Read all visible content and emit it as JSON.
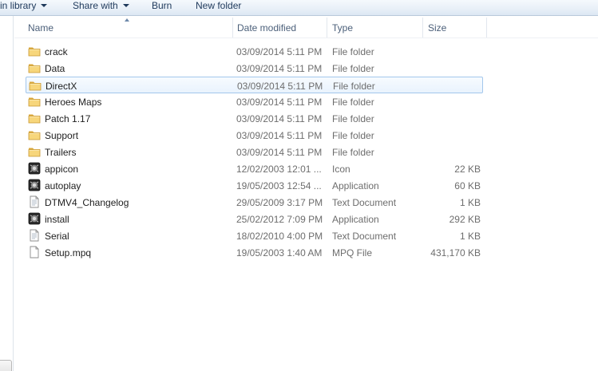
{
  "toolbar": {
    "include_in_library": "in library",
    "share_with": "Share with",
    "burn": "Burn",
    "new_folder": "New folder"
  },
  "columns": {
    "name": "Name",
    "date_modified": "Date modified",
    "type": "Type",
    "size": "Size"
  },
  "files": [
    {
      "name": "crack",
      "date": "03/09/2014 5:11 PM",
      "type": "File folder",
      "size": "",
      "icon": "folder-icon"
    },
    {
      "name": "Data",
      "date": "03/09/2014 5:11 PM",
      "type": "File folder",
      "size": "",
      "icon": "folder-icon"
    },
    {
      "name": "DirectX",
      "date": "03/09/2014 5:11 PM",
      "type": "File folder",
      "size": "",
      "icon": "folder-icon",
      "selected": true
    },
    {
      "name": "Heroes Maps",
      "date": "03/09/2014 5:11 PM",
      "type": "File folder",
      "size": "",
      "icon": "folder-icon"
    },
    {
      "name": "Patch 1.17",
      "date": "03/09/2014 5:11 PM",
      "type": "File folder",
      "size": "",
      "icon": "folder-icon"
    },
    {
      "name": "Support",
      "date": "03/09/2014 5:11 PM",
      "type": "File folder",
      "size": "",
      "icon": "folder-icon"
    },
    {
      "name": "Trailers",
      "date": "03/09/2014 5:11 PM",
      "type": "File folder",
      "size": "",
      "icon": "folder-icon"
    },
    {
      "name": "appicon",
      "date": "12/02/2003 12:01 ...",
      "type": "Icon",
      "size": "22 KB",
      "icon": "game-icon"
    },
    {
      "name": "autoplay",
      "date": "19/05/2003 12:54 ...",
      "type": "Application",
      "size": "60 KB",
      "icon": "game-icon"
    },
    {
      "name": "DTMV4_Changelog",
      "date": "29/05/2009 3:17 PM",
      "type": "Text Document",
      "size": "1 KB",
      "icon": "text-document-icon"
    },
    {
      "name": "install",
      "date": "25/02/2012 7:09 PM",
      "type": "Application",
      "size": "292 KB",
      "icon": "game-icon"
    },
    {
      "name": "Serial",
      "date": "18/02/2010 4:00 PM",
      "type": "Text Document",
      "size": "1 KB",
      "icon": "text-document-icon"
    },
    {
      "name": "Setup.mpq",
      "date": "19/05/2003 1:40 AM",
      "type": "MPQ File",
      "size": "431,170 KB",
      "icon": "blank-file-icon"
    }
  ]
}
